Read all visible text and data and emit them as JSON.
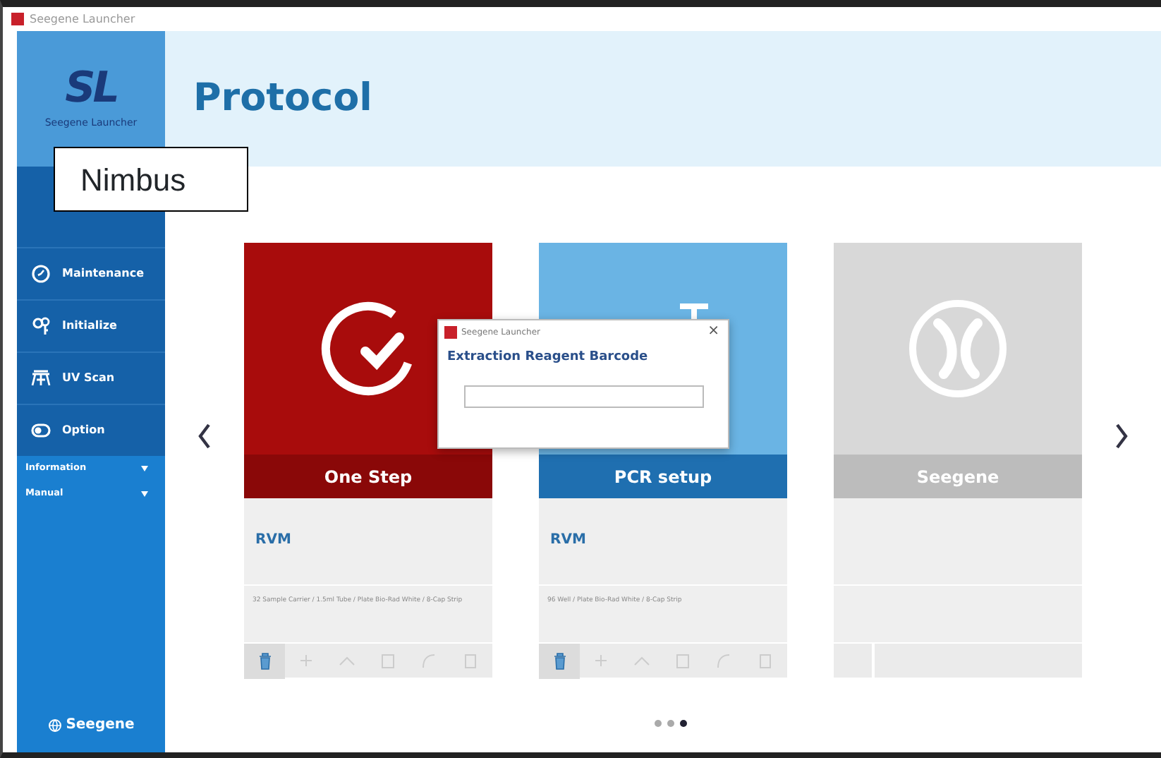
{
  "window": {
    "title": "Seegene Launcher"
  },
  "sidebar": {
    "logo_mark": "SL",
    "logo_name": "Seegene Launcher",
    "items": [
      {
        "label": "Maintenance"
      },
      {
        "label": "Initialize"
      },
      {
        "label": "UV Scan"
      },
      {
        "label": "Option"
      }
    ],
    "sections": [
      {
        "label": "Information",
        "expanded": false
      },
      {
        "label": "Manual",
        "expanded": false
      }
    ],
    "footer": "Seegene"
  },
  "header": {
    "title": "Protocol"
  },
  "annotation": "Nimbus",
  "cards": [
    {
      "kind": "red",
      "title": "One Step",
      "name": "RVM",
      "description": "32 Sample Carrier / 1.5ml Tube / Plate Bio-Rad White / 8-Cap Strip"
    },
    {
      "kind": "blue",
      "title": "PCR setup",
      "name": "RVM",
      "description": "96 Well / Plate Bio-Rad White / 8-Cap Strip"
    },
    {
      "kind": "grey",
      "title": "Seegene"
    }
  ],
  "pager": [
    {
      "selected": false
    },
    {
      "selected": false
    },
    {
      "selected": true
    }
  ],
  "dialog": {
    "title": "Seegene Launcher",
    "close": "×",
    "heading": "Extraction Reagent Barcode"
  }
}
